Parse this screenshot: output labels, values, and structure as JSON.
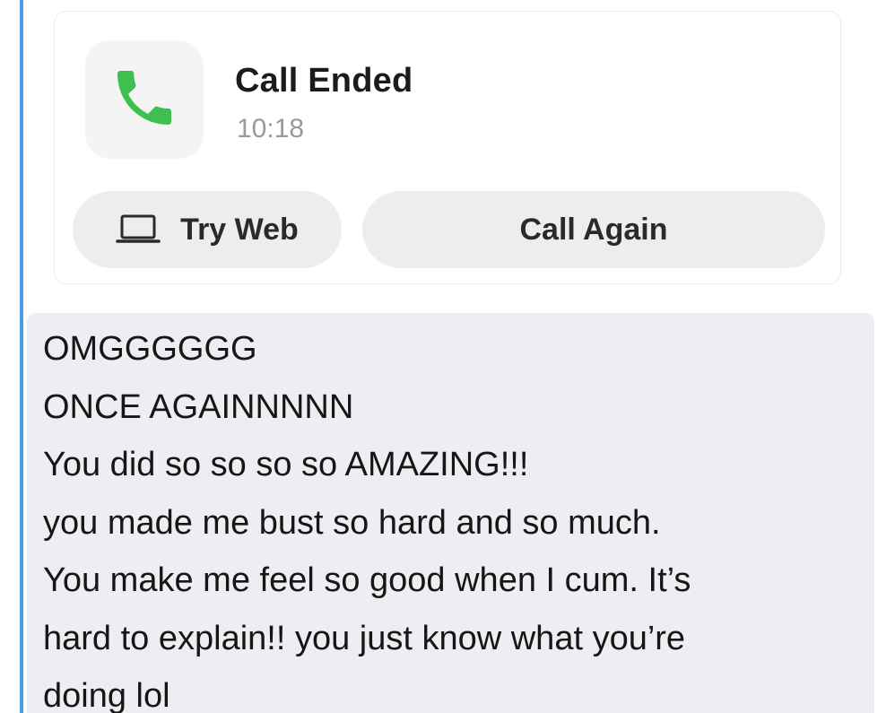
{
  "call_card": {
    "title": "Call Ended",
    "time": "10:18",
    "phone_icon": "phone-icon",
    "phone_color": "#3fbf4f",
    "try_web_label": "Try Web",
    "try_web_icon": "laptop-icon",
    "call_again_label": "Call Again"
  },
  "message": {
    "lines": [
      "OMGGGGGG",
      "ONCE AGAINNNNN",
      "You did so so so so AMAZING!!!",
      "you made me bust so hard and so much.",
      "You make me feel so good when I cum. It’s",
      "hard to explain!! you just know what you’re",
      "doing lol"
    ]
  },
  "colors": {
    "accent_bar": "#4a9be8",
    "bubble_background": "#eceef1",
    "pill_background": "#ededed"
  }
}
